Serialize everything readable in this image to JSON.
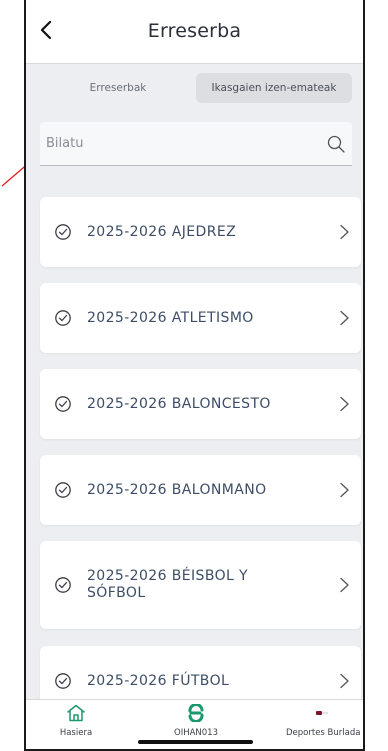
{
  "header": {
    "title": "Erreserba"
  },
  "tabs": [
    {
      "label": "Erreserbak",
      "active": false
    },
    {
      "label": "Ikasgaien izen-emateak",
      "active": true
    }
  ],
  "search": {
    "placeholder": "Bilatu",
    "value": ""
  },
  "courses": [
    {
      "label": "2025-2026 AJEDREZ"
    },
    {
      "label": "2025-2026 ATLETISMO"
    },
    {
      "label": "2025-2026 BALONCESTO"
    },
    {
      "label": "2025-2026 BALONMANO"
    },
    {
      "label": "2025-2026 BÉISBOL Y SÓFBOL"
    },
    {
      "label": "2025-2026 FÚTBOL"
    }
  ],
  "bottom_nav": {
    "home_label": "Hasiera",
    "user_label": "OIHAN013",
    "org_label": "Deportes Burlada"
  },
  "colors": {
    "accent_green": "#1a9a6c",
    "card_text": "#3d4d66",
    "annotation_red": "#e8141c",
    "background": "#eceef1"
  }
}
